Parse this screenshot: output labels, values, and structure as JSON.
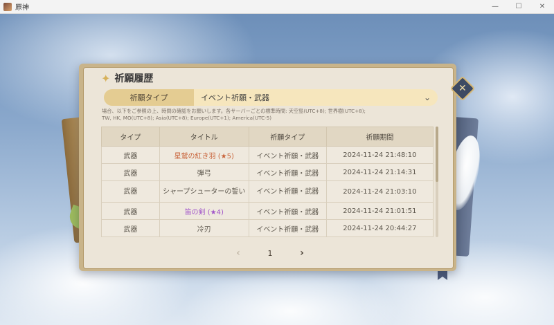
{
  "window": {
    "title": "原神",
    "minimize": "—",
    "maximize": "☐",
    "close": "✕"
  },
  "panel": {
    "title": "祈願履歴",
    "close_icon": "✕"
  },
  "filter": {
    "label": "祈願タイプ",
    "value": "イベント祈願・武器"
  },
  "notice": {
    "line1": "場合、以下をご参照の上、時間の確認をお願いします。各サーバーごとの標準時間: 天空島(UTC+8); 世界樹(UTC+8);",
    "line2": "TW, HK, MO(UTC+8); Asia(UTC+8); Europe(UTC+1); America(UTC-5)"
  },
  "table": {
    "headers": [
      "タイプ",
      "タイトル",
      "祈願タイプ",
      "祈願期間"
    ],
    "rows": [
      {
        "type": "武器",
        "title": "星鷲の紅き羽 (★5)",
        "wish": "イベント祈願・武器",
        "time": "2024-11-24 21:48:10",
        "rarity": "5"
      },
      {
        "type": "武器",
        "title": "弾弓",
        "wish": "イベント祈願・武器",
        "time": "2024-11-24 21:14:31",
        "rarity": "3"
      },
      {
        "type": "武器",
        "title": "シャープシューターの誓い",
        "wish": "イベント祈願・武器",
        "time": "2024-11-24 21:03:10",
        "rarity": "3"
      },
      {
        "type": "武器",
        "title": "笛の剣 (★4)",
        "wish": "イベント祈願・武器",
        "time": "2024-11-24 21:01:51",
        "rarity": "4"
      },
      {
        "type": "武器",
        "title": "冷刃",
        "wish": "イベント祈願・武器",
        "time": "2024-11-24 20:44:27",
        "rarity": "3"
      }
    ]
  },
  "pagination": {
    "current": "1",
    "prev": "‹",
    "next": "›"
  },
  "colors": {
    "rarity5": "#c8633a",
    "rarity4": "#a155c9"
  }
}
